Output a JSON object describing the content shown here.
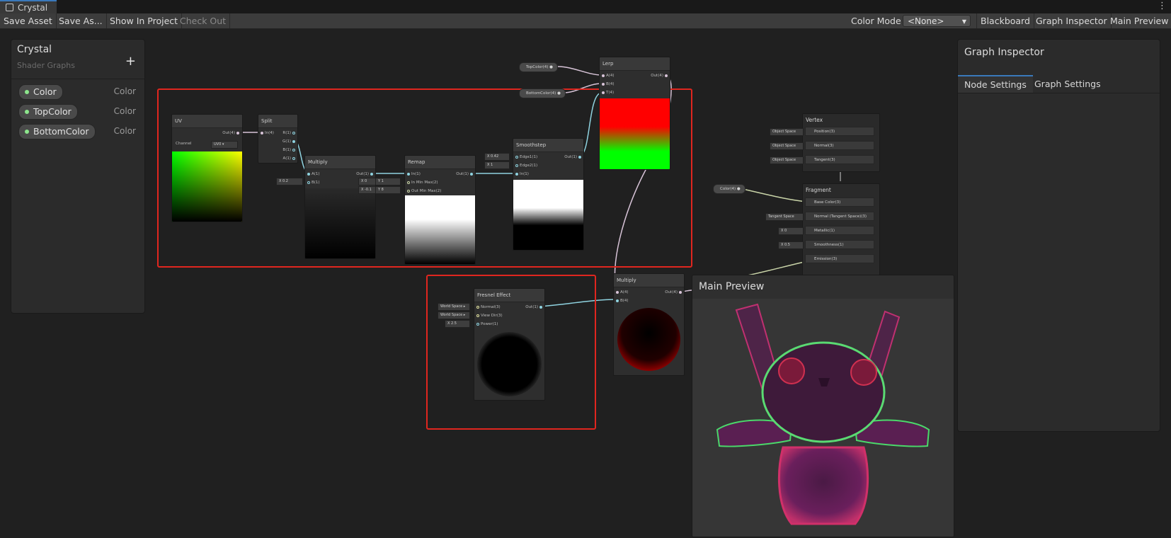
{
  "window": {
    "tab_title": "Crystal"
  },
  "toolbar": {
    "save_asset": "Save Asset",
    "save_as": "Save As...",
    "show_in_project": "Show In Project",
    "check_out": "Check Out",
    "color_mode_label": "Color Mode",
    "color_mode_value": "<None>",
    "blackboard": "Blackboard",
    "graph_inspector": "Graph Inspector",
    "main_preview": "Main Preview"
  },
  "blackboard": {
    "title": "Crystal",
    "subtitle": "Shader Graphs",
    "add": "+",
    "properties": [
      {
        "name": "Color",
        "type": "Color"
      },
      {
        "name": "TopColor",
        "type": "Color"
      },
      {
        "name": "BottomColor",
        "type": "Color"
      }
    ]
  },
  "inspector": {
    "title": "Graph Inspector",
    "tabs": [
      "Node Settings",
      "Graph Settings"
    ]
  },
  "preview": {
    "title": "Main Preview"
  },
  "nodes": {
    "uv": {
      "title": "UV",
      "out": "Out(4)",
      "channel_label": "Channel",
      "channel_value": "UV0"
    },
    "split": {
      "title": "Split",
      "in": "In(4)",
      "outs": [
        "R(1)",
        "G(1)",
        "B(1)",
        "A(1)"
      ]
    },
    "multiply1": {
      "title": "Multiply",
      "a": "A(1)",
      "b": "B(1)",
      "out": "Out(1)",
      "b_value": "0.2",
      "x": "X"
    },
    "remap": {
      "title": "Remap",
      "in": "In(1)",
      "in_minmax": "In Min Max(2)",
      "out_minmax": "Out Min Max(2)",
      "out": "Out(1)",
      "in_min": "0",
      "in_max": "1",
      "out_min": "-0.1",
      "out_max": "8",
      "x": "X",
      "y": "Y"
    },
    "smoothstep": {
      "title": "Smoothstep",
      "edge1": "Edge1(1)",
      "edge2": "Edge2(1)",
      "in": "In(1)",
      "out": "Out(1)",
      "edge1_value": "0.42",
      "edge2_value": "1"
    },
    "lerp": {
      "title": "Lerp",
      "a": "A(4)",
      "b": "B(4)",
      "t": "T(4)",
      "out": "Out(4)"
    },
    "fresnel": {
      "title": "Fresnel Effect",
      "normal": "Normal(3)",
      "view_dir": "View Dir(3)",
      "power": "Power(1)",
      "out": "Out(1)",
      "normal_space": "World Space",
      "view_space": "World Space",
      "power_value": "2.5"
    },
    "multiply2": {
      "title": "Multiply",
      "a": "A(4)",
      "b": "B(4)",
      "out": "Out(4)"
    }
  },
  "property_nodes": {
    "top_color": "TopColor(4)",
    "bottom_color": "BottomColor(4)",
    "color": "Color(4)"
  },
  "master": {
    "vertex_title": "Vertex",
    "vertex_slots": [
      "Position(3)",
      "Normal(3)",
      "Tangent(3)"
    ],
    "vertex_spaces": [
      "Object Space",
      "Object Space",
      "Object Space"
    ],
    "fragment_title": "Fragment",
    "fragment_slots": [
      "Base Color(3)",
      "Normal (Tangent Space)(3)",
      "Metallic(1)",
      "Smoothness(1)",
      "Emission(3)"
    ],
    "normal_space": "Tangent Space",
    "metallic_value": "0",
    "smoothness_value": "0.5"
  },
  "colors": {
    "highlight": "#e0261f",
    "accent": "#3a79bb",
    "property_dot": "#8ce68c"
  }
}
